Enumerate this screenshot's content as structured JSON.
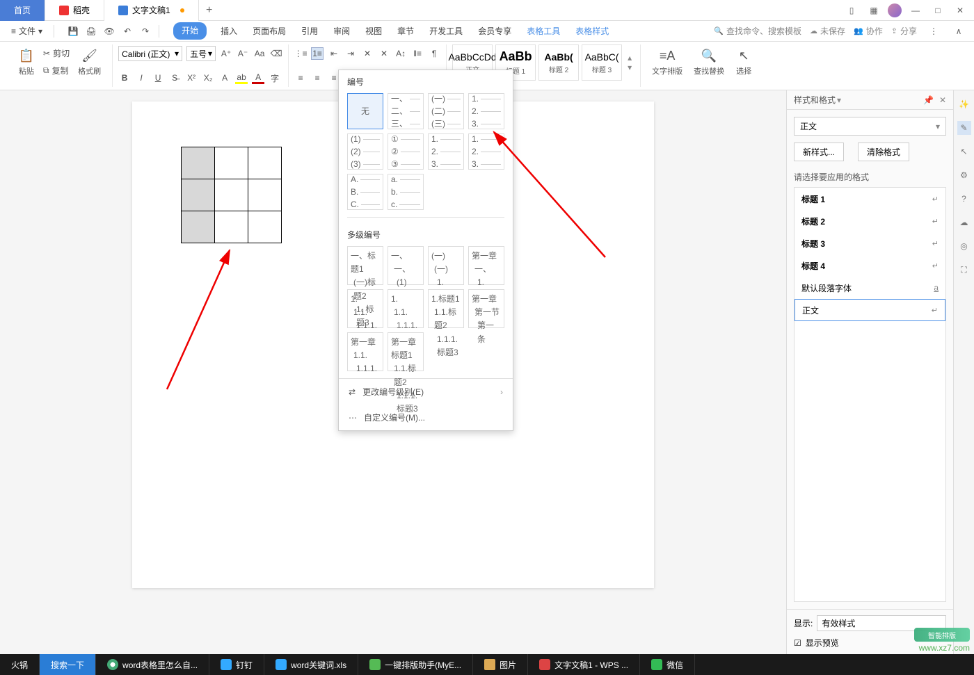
{
  "titlebar": {
    "home": "首页",
    "daoke": "稻壳",
    "doc": "文字文稿1",
    "add": "+"
  },
  "menubar": {
    "file": "文件",
    "tabs": [
      "开始",
      "插入",
      "页面布局",
      "引用",
      "审阅",
      "视图",
      "章节",
      "开发工具",
      "会员专享",
      "表格工具",
      "表格样式"
    ],
    "search_placeholder": "查找命令、搜索模板",
    "cloud": "未保存",
    "collab": "协作",
    "share": "分享"
  },
  "ribbon": {
    "paste": "粘贴",
    "cut": "剪切",
    "copy": "复制",
    "format_painter": "格式刷",
    "font_name": "Calibri (正文)",
    "font_size": "五号",
    "styles": [
      {
        "preview": "AaBbCcDd",
        "name": "正文"
      },
      {
        "preview": "AaBb",
        "name": "标题 1"
      },
      {
        "preview": "AaBb(",
        "name": "标题 2"
      },
      {
        "preview": "AaBbC(",
        "name": "标题 3"
      }
    ],
    "text_layout": "文字排版",
    "find_replace": "查找替换",
    "select": "选择"
  },
  "numbering": {
    "header": "编号",
    "none": "无",
    "row1": [
      [
        "一、",
        "二、",
        "三、"
      ],
      [
        "(一)",
        "(二)",
        "(三)"
      ],
      [
        "1.",
        "2.",
        "3."
      ]
    ],
    "row2": [
      [
        "(1)",
        "(2)",
        "(3)"
      ],
      [
        "①",
        "②",
        "③"
      ],
      [
        "1.",
        "2.",
        "3."
      ],
      [
        "1.",
        "2.",
        "3."
      ]
    ],
    "row3": [
      [
        "A.",
        "B.",
        "C."
      ],
      [
        "a.",
        "b.",
        "c."
      ]
    ],
    "ml_header": "多级编号",
    "ml1": [
      [
        "一、标题1",
        "(一)标题2",
        "1. 标题3"
      ],
      [
        "一、",
        "一、",
        "(1)"
      ],
      [
        "(一)",
        "(一)",
        "1."
      ],
      [
        "第一章",
        "一、",
        "1."
      ]
    ],
    "ml2": [
      [
        "1.",
        "1.1.",
        "1.1.1."
      ],
      [
        "1.",
        "1.1.",
        "1.1.1."
      ],
      [
        "1.标题1",
        "1.1.标题2",
        "1.1.1.标题3"
      ],
      [
        "第一章",
        "第一节",
        "第一条"
      ]
    ],
    "ml3": [
      [
        "第一章",
        "1.1.",
        "1.1.1."
      ],
      [
        "第一章标题1",
        "1.1.标题2",
        "1.1.1.标题3"
      ]
    ],
    "change_level": "更改编号级别(E)",
    "custom": "自定义编号(M)..."
  },
  "rightpanel": {
    "title": "样式和格式",
    "current": "正文",
    "new_style": "新样式...",
    "clear_format": "清除格式",
    "apply_label": "请选择要应用的格式",
    "styles": [
      "标题 1",
      "标题 2",
      "标题 3",
      "标题 4",
      "默认段落字体",
      "正文"
    ],
    "show_label": "显示:",
    "show_value": "有效样式",
    "preview_chk": "显示预览"
  },
  "taskbar": {
    "items": [
      "火锅",
      "搜索一下",
      "word表格里怎么自...",
      "钉钉",
      "word关键词.xls",
      "一键排版助手(MyE...",
      "图片",
      "文字文稿1 - WPS ...",
      "微信"
    ]
  },
  "watermark": {
    "site": "www.xz7.com",
    "name": "智能排版"
  }
}
